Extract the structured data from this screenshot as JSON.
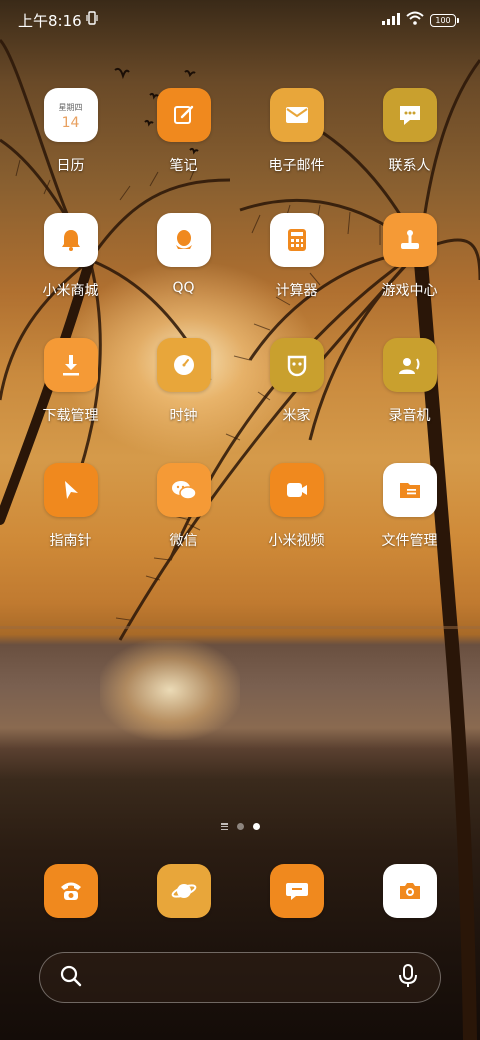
{
  "status_bar": {
    "time": "上午8:16",
    "battery": "100"
  },
  "apps": [
    {
      "label": "日历",
      "icon": "calendar-icon",
      "bg": "#ffffff",
      "calendar_weekday": "星期四",
      "calendar_day": "14"
    },
    {
      "label": "笔记",
      "icon": "notes-icon",
      "bg": "#f0891e"
    },
    {
      "label": "电子邮件",
      "icon": "mail-icon",
      "bg": "#e8a63a"
    },
    {
      "label": "联系人",
      "icon": "contacts-icon",
      "bg": "#c9a02e"
    },
    {
      "label": "小米商城",
      "icon": "bell-icon",
      "bg": "#ffffff"
    },
    {
      "label": "QQ",
      "icon": "qq-icon",
      "bg": "#ffffff"
    },
    {
      "label": "计算器",
      "icon": "calculator-icon",
      "bg": "#ffffff"
    },
    {
      "label": "游戏中心",
      "icon": "joystick-icon",
      "bg": "#f59a36"
    },
    {
      "label": "下载管理",
      "icon": "download-icon",
      "bg": "#f59a36"
    },
    {
      "label": "时钟",
      "icon": "clock-icon",
      "bg": "#e8a63a"
    },
    {
      "label": "米家",
      "icon": "mijia-icon",
      "bg": "#c9a02e"
    },
    {
      "label": "录音机",
      "icon": "recorder-icon",
      "bg": "#c9a02e"
    },
    {
      "label": "指南针",
      "icon": "compass-icon",
      "bg": "#f0891e"
    },
    {
      "label": "微信",
      "icon": "wechat-icon",
      "bg": "#f59a36"
    },
    {
      "label": "小米视频",
      "icon": "video-icon",
      "bg": "#f0891e"
    },
    {
      "label": "文件管理",
      "icon": "folder-icon",
      "bg": "#ffffff"
    }
  ],
  "page_indicator": {
    "pages": 2,
    "active": 2
  },
  "dock": [
    {
      "name": "phone",
      "icon": "phone-icon",
      "bg": "#f0891e"
    },
    {
      "name": "browser",
      "icon": "browser-icon",
      "bg": "#e8a63a"
    },
    {
      "name": "messages",
      "icon": "message-icon",
      "bg": "#f0891e"
    },
    {
      "name": "camera",
      "icon": "camera-icon",
      "bg": "#ffffff"
    }
  ],
  "search": {
    "placeholder": ""
  },
  "colors": {
    "accent_orange": "#f0891e",
    "accent_gold": "#c9a02e",
    "white": "#ffffff"
  }
}
